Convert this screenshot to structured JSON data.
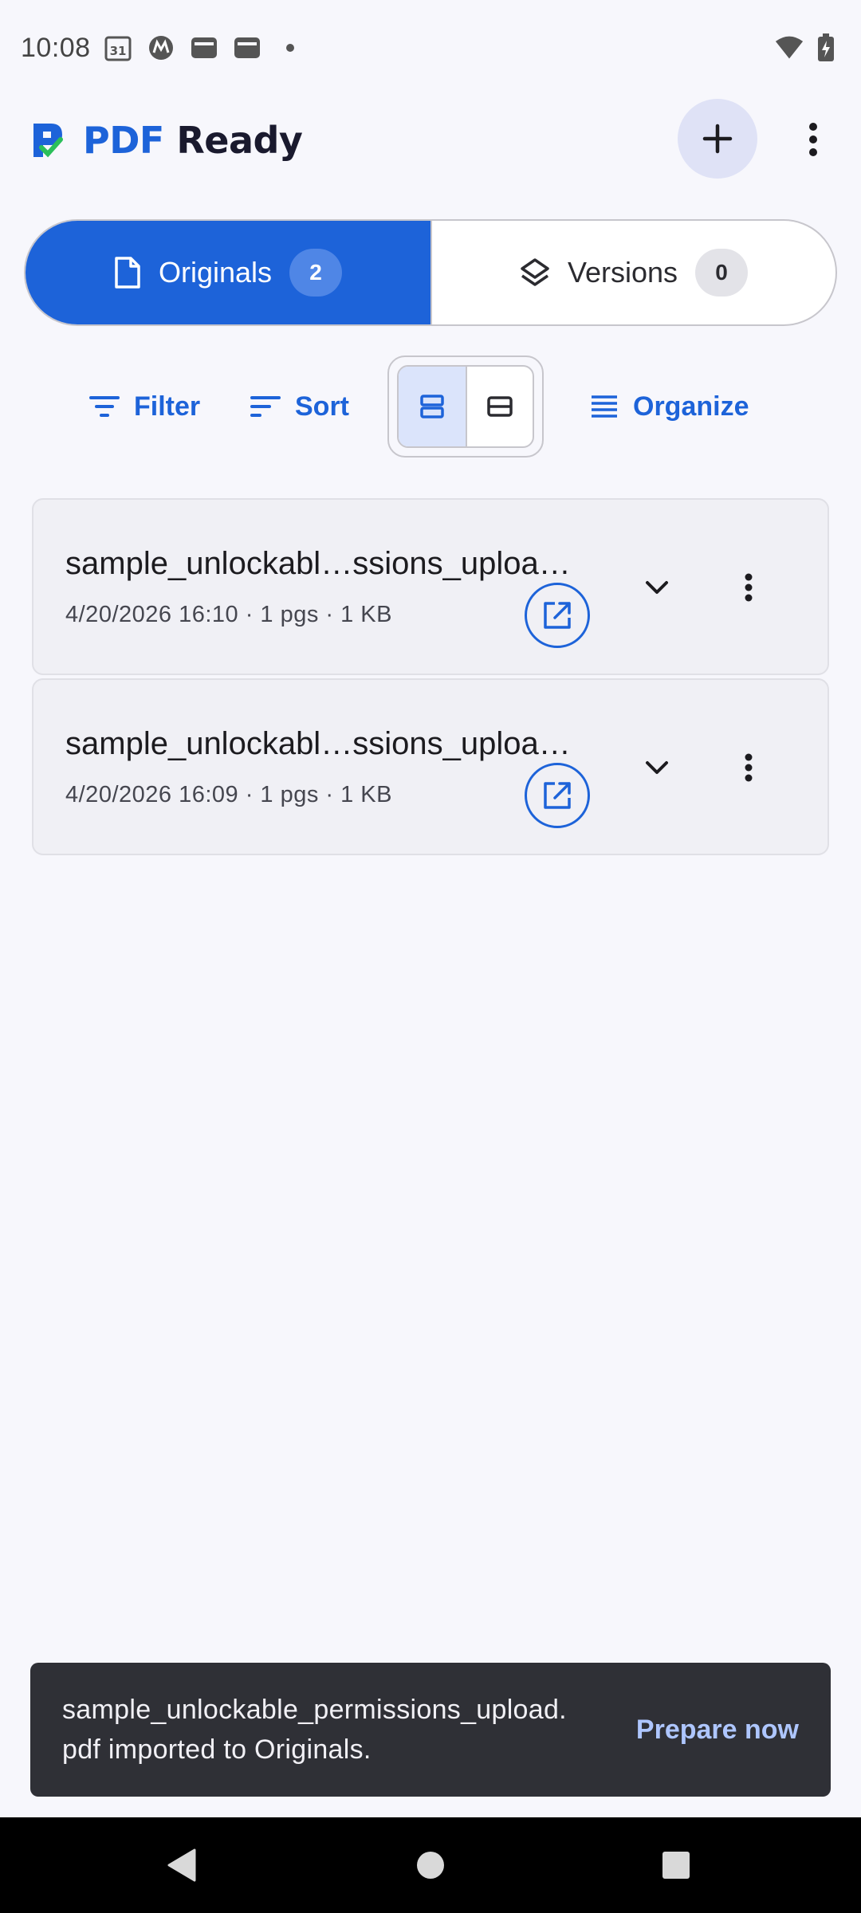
{
  "status_bar": {
    "time": "10:08",
    "calendar_day": "31",
    "icons": [
      "calendar-icon",
      "motorola-icon",
      "wallet-icon",
      "wallet-icon",
      "dot-icon",
      "wifi-icon",
      "battery-charging-icon"
    ]
  },
  "app_bar": {
    "title_part1": "PDF",
    "title_part2": "Ready",
    "add_icon": "plus-icon",
    "more_icon": "more-vert-icon"
  },
  "tabs": [
    {
      "label": "Originals",
      "count": "2",
      "icon": "file-icon",
      "active": true
    },
    {
      "label": "Versions",
      "count": "0",
      "icon": "layers-icon",
      "active": false
    }
  ],
  "toolbar": {
    "filter_label": "Filter",
    "sort_label": "Sort",
    "organize_label": "Organize",
    "view_options": [
      "expanded-view-icon",
      "compact-view-icon"
    ],
    "selected_view": "expanded-view-icon"
  },
  "files": [
    {
      "name": "sample_unlockabl…ssions_uploa…",
      "meta": "4/20/2026 16:10 · 1 pgs · 1 KB"
    },
    {
      "name": "sample_unlockabl…ssions_uploa…",
      "meta": "4/20/2026 16:09 · 1 pgs · 1 KB"
    }
  ],
  "snackbar": {
    "message": "sample_unlockable_permissions_upload.pdf imported to Originals.",
    "action": "Prepare now"
  },
  "colors": {
    "primary": "#1d63d9",
    "background": "#f7f7fc",
    "snackbar": "#2f3036",
    "snackbar_action": "#aec6ff"
  }
}
